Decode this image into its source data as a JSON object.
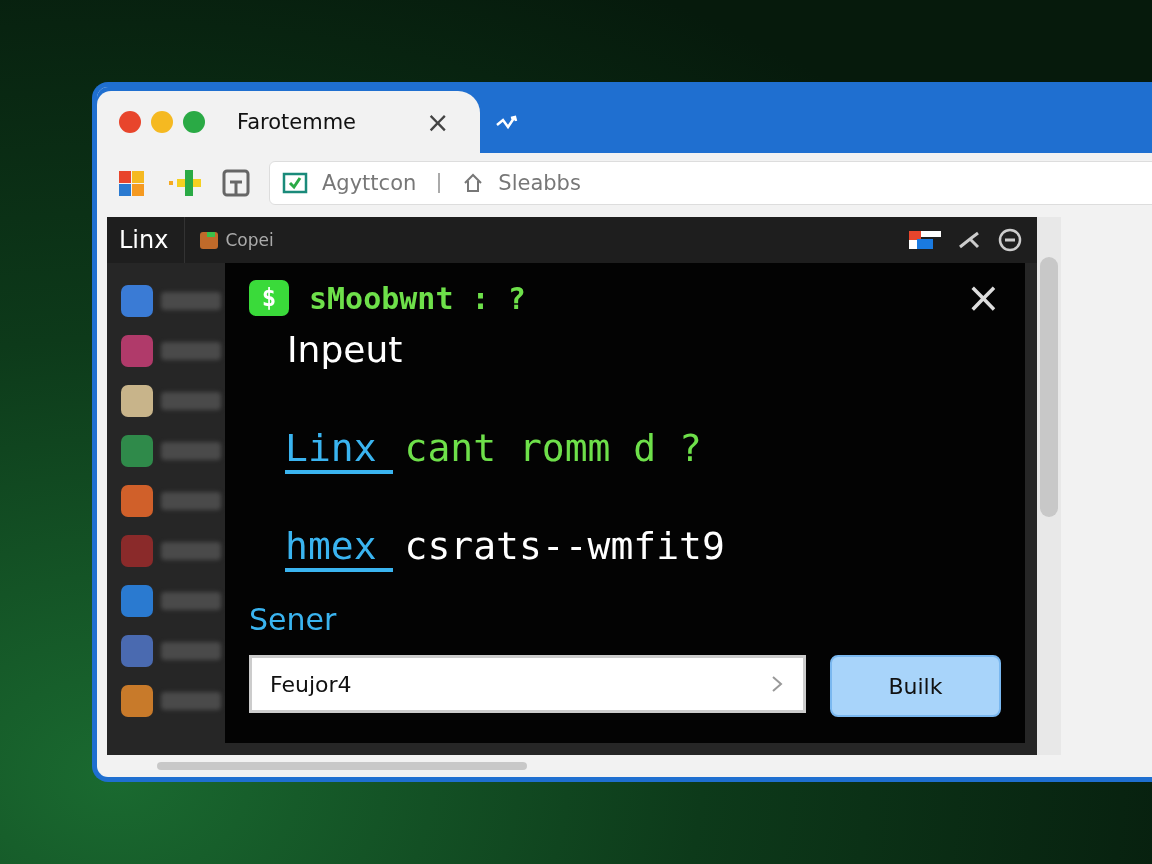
{
  "browser": {
    "tab": {
      "title": "Farotemme",
      "close": "×"
    },
    "address": {
      "value": "Agyttcon",
      "secondary": "Sleabbs"
    }
  },
  "app": {
    "title": "Linx",
    "tab": "Copei"
  },
  "sidebar_items": [
    {
      "color": "#3a7bd5"
    },
    {
      "color": "#b03a6a"
    },
    {
      "color": "#c8b48a"
    },
    {
      "color": "#2f8a4a"
    },
    {
      "color": "#d0602a"
    },
    {
      "color": "#8a2a2a"
    },
    {
      "color": "#2a7ad0"
    },
    {
      "color": "#4a6ab0"
    },
    {
      "color": "#c87a2a"
    }
  ],
  "dialog": {
    "badge": "$",
    "title": "sMoobwnt : ?",
    "close": "×",
    "heading": "Inpeut",
    "lines": [
      {
        "link": "Linx",
        "text": "cant romm d ?",
        "kind": "green"
      },
      {
        "link": "hmex",
        "text": "csrats--wmfit9",
        "kind": "white"
      }
    ],
    "label": "Sener",
    "input": {
      "value": "Feujor4"
    },
    "button": "Builk"
  }
}
